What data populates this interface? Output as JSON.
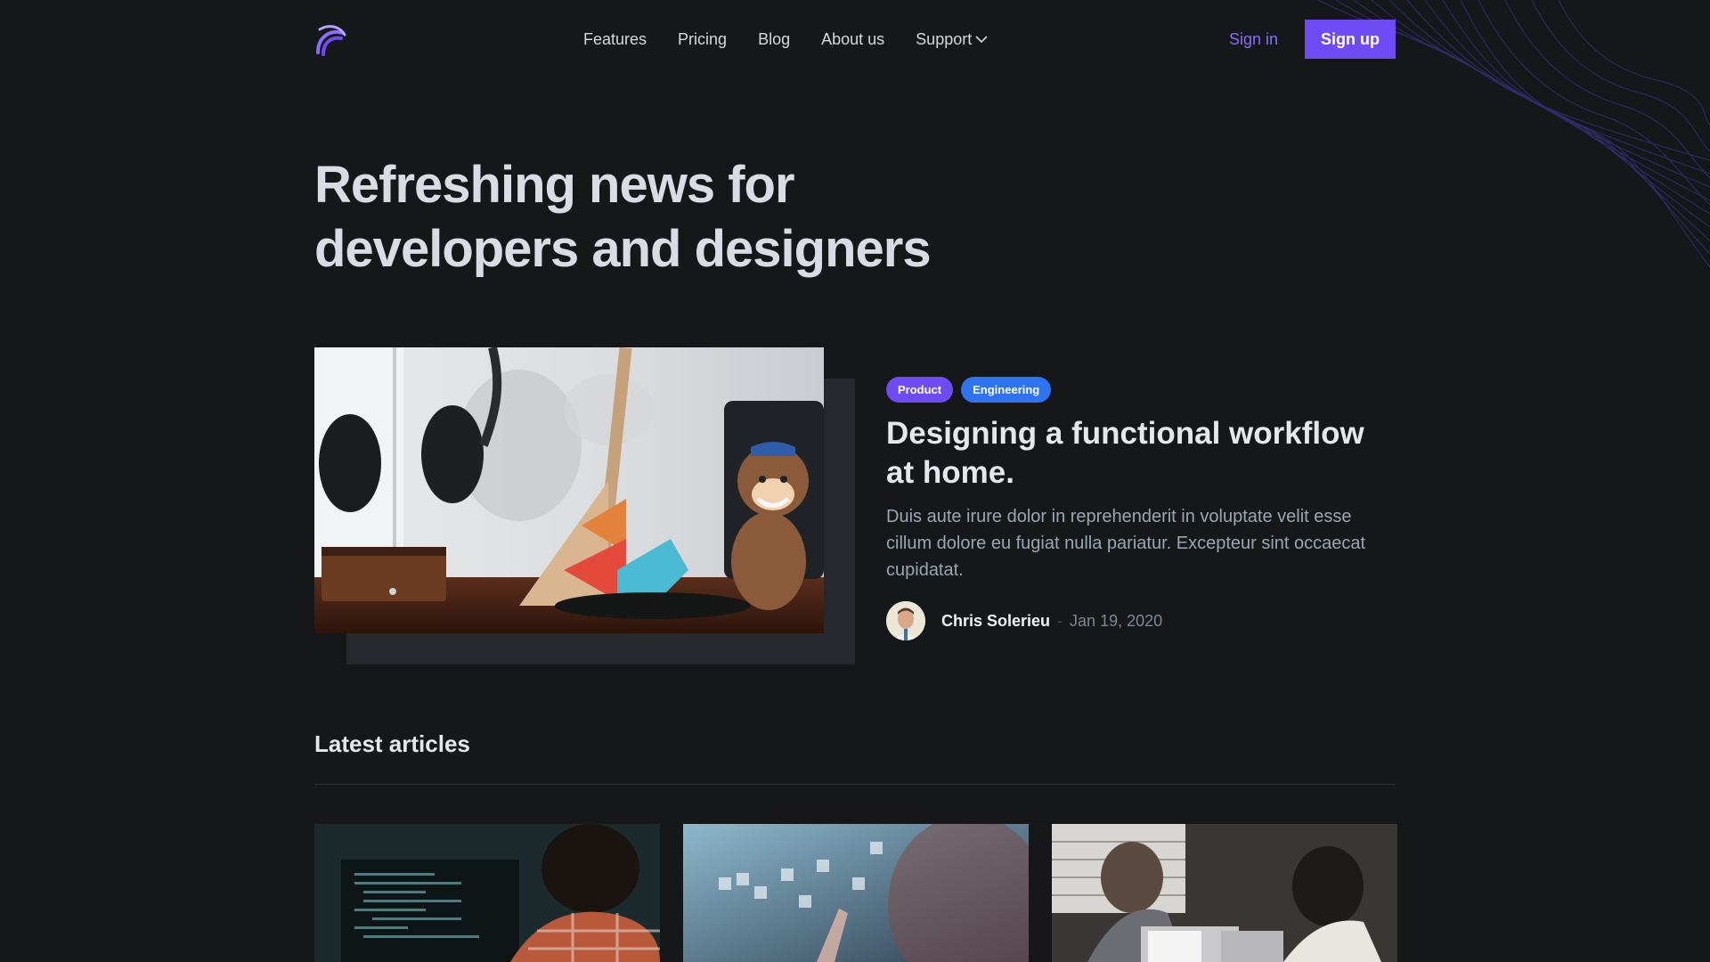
{
  "brand": {
    "accent": "#6d4cf5",
    "accent_text": "#8a6cff",
    "background": "#151719",
    "logo_icon": "rainbow-arch-logo"
  },
  "nav": {
    "items": [
      {
        "label": "Features"
      },
      {
        "label": "Pricing"
      },
      {
        "label": "Blog"
      },
      {
        "label": "About us"
      },
      {
        "label": "Support",
        "icon": "chevron-down-icon"
      }
    ]
  },
  "auth": {
    "signin_label": "Sign in",
    "signup_label": "Sign up"
  },
  "hero": {
    "title_line1": "Refreshing news for",
    "title_line2": "developers and designers"
  },
  "featured": {
    "tags": [
      {
        "label": "Product",
        "color": "#6d4cf5"
      },
      {
        "label": "Engineering",
        "color": "#2f73f0"
      }
    ],
    "title": "Designing a functional workflow at home.",
    "excerpt": "Duis aute irure dolor in reprehenderit in voluptate velit esse cillum dolore eu fugiat nulla pariatur. Excepteur sint occaecat cupidatat.",
    "author": "Chris Solerieu",
    "separator": "-",
    "date": "Jan 19, 2020"
  },
  "latest": {
    "title": "Latest articles"
  }
}
